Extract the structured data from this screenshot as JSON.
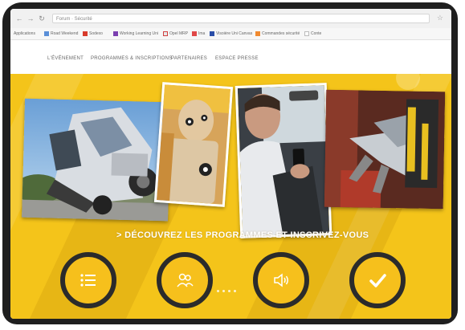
{
  "browser": {
    "address": "Forum · Sécurité",
    "bookmarks": [
      "Applications",
      "Road Weekend",
      "Sodexo",
      "Working Learning Uni",
      "Opel MRP",
      "Ima",
      "Visoière Uni Canvas",
      "Commandes sécurité",
      "Conte"
    ]
  },
  "nav": {
    "items": [
      "L'ÉVÉNEMENT",
      "PROGRAMMES & INSCRIPTIONS",
      "PARTENAIRES",
      "ESPACE PRESSE"
    ]
  },
  "hero": {
    "banner": "> DÉCOUVREZ LES PROGRAMMES ET INSCRIVEZ-VOUS",
    "features": [
      {
        "icon": "list-icon"
      },
      {
        "icon": "people-icon"
      },
      {
        "icon": "speaker-icon"
      },
      {
        "icon": "checkmark-icon"
      }
    ]
  },
  "colors": {
    "accent": "#f4c41a",
    "ring": "#2b2b2b"
  }
}
